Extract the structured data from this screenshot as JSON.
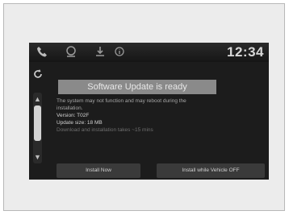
{
  "status_bar": {
    "icons": [
      "phone-icon",
      "navigation-icon",
      "download-icon",
      "info-icon"
    ],
    "clock": "12:34"
  },
  "sidebar": {
    "icon": "refresh-icon"
  },
  "dialog": {
    "title": "Software Update is ready",
    "message_lines": [
      "The system may not function and may reboot during the",
      "installation."
    ],
    "version": "Version: T02F",
    "update_size": "Update size: 18 MB",
    "note": "Download and installation takes ~15 mins"
  },
  "buttons": {
    "install_now": "Install Now",
    "install_while_off": "Install while Vehicle OFF"
  }
}
